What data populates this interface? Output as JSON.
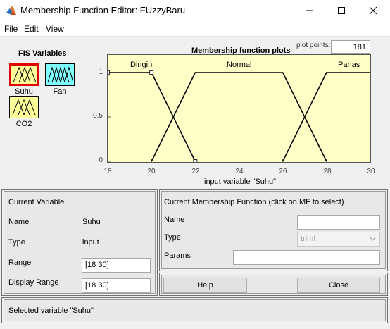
{
  "window": {
    "title": "Membership Function Editor: FUzzyBaru",
    "minimize_icon": "minimize-icon",
    "maximize_icon": "maximize-icon",
    "close_icon": "close-icon"
  },
  "menu": {
    "items": [
      "File",
      "Edit",
      "View"
    ]
  },
  "fis_variables": {
    "heading": "FIS Variables",
    "inputs": [
      {
        "label": "Suhu",
        "color": "#ffff99",
        "selected": true,
        "label_color": "#e00000"
      },
      {
        "label": "CO2",
        "color": "#ffff99",
        "selected": false,
        "label_color": "#000000"
      }
    ],
    "outputs": [
      {
        "label": "Fan",
        "color": "#80ffff",
        "selected": false,
        "label_color": "#000000"
      }
    ]
  },
  "plot": {
    "title": "Membership function plots",
    "plot_points_label": "plot points:",
    "plot_points_value": "181",
    "x_label": "input variable \"Suhu\"",
    "x_ticks": [
      "18",
      "20",
      "22",
      "24",
      "26",
      "28",
      "30"
    ],
    "y_ticks": [
      "1",
      "0.5",
      "0"
    ],
    "background_color": "#ffffc8"
  },
  "chart_data": {
    "type": "line",
    "xlim": [
      18,
      30
    ],
    "ylim": [
      0,
      1
    ],
    "xlabel": "input variable \"Suhu\"",
    "title": "Membership function plots",
    "series": [
      {
        "name": "Dingin",
        "x": [
          18,
          20,
          22
        ],
        "y": [
          1,
          1,
          0
        ]
      },
      {
        "name": "Normal",
        "x": [
          20,
          22,
          26,
          28
        ],
        "y": [
          0,
          1,
          1,
          0
        ]
      },
      {
        "name": "Panas",
        "x": [
          26,
          28,
          30
        ],
        "y": [
          0,
          1,
          1
        ]
      }
    ]
  },
  "current_variable": {
    "heading": "Current Variable",
    "name_label": "Name",
    "name_value": "Suhu",
    "type_label": "Type",
    "type_value": "input",
    "range_label": "Range",
    "range_value": "[18 30]",
    "display_range_label": "Display Range",
    "display_range_value": "[18 30]"
  },
  "current_mf": {
    "heading": "Current Membership Function (click on MF to select)",
    "name_label": "Name",
    "name_value": "",
    "type_label": "Type",
    "type_value": "trimf",
    "params_label": "Params",
    "params_value": ""
  },
  "buttons": {
    "help": "Help",
    "close": "Close"
  },
  "status": {
    "text": "Selected variable \"Suhu\""
  }
}
